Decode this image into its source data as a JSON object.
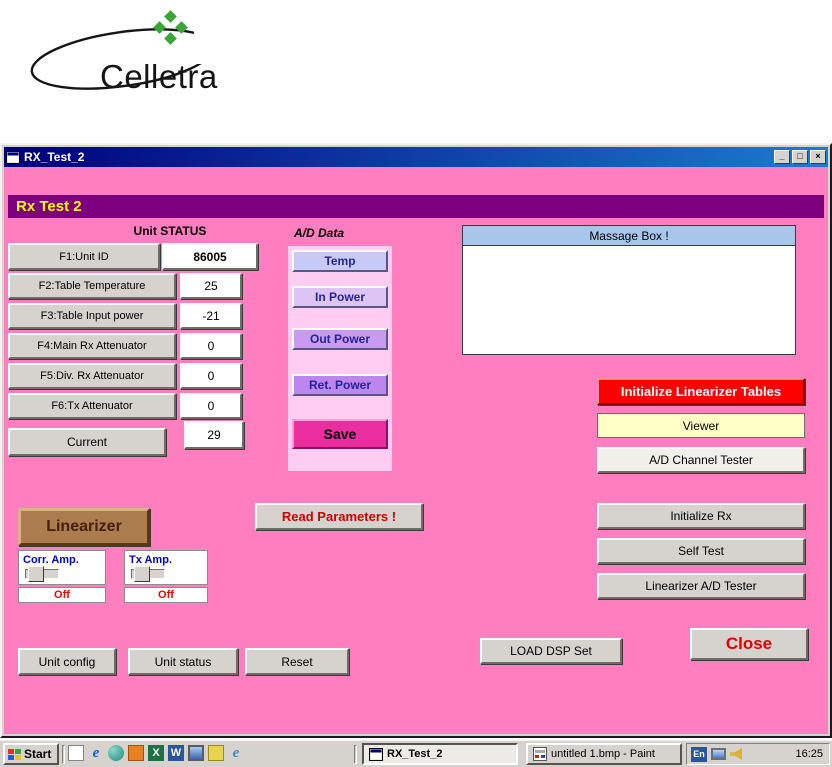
{
  "brand": {
    "name": "Celletra"
  },
  "window": {
    "title": "RX_Test_2",
    "page_title": "Rx Test 2",
    "controls": {
      "minimize": "_",
      "maximize": "□",
      "close": "×"
    }
  },
  "status_panel": {
    "header": "Unit STATUS",
    "rows": [
      {
        "label": "F1:Unit ID",
        "value": "86005"
      },
      {
        "label": "F2:Table Temperature",
        "value": "25"
      },
      {
        "label": "F3:Table Input power",
        "value": "-21"
      },
      {
        "label": "F4:Main Rx Attenuator",
        "value": "0"
      },
      {
        "label": "F5:Div. Rx Attenuator",
        "value": "0"
      },
      {
        "label": "F6:Tx Attenuator",
        "value": "0"
      }
    ],
    "current_label": "Current",
    "current_value": "29"
  },
  "ad_panel": {
    "header": "A/D Data",
    "channels": [
      "Temp",
      "In Power",
      "Out Power",
      "Ret. Power"
    ],
    "save": "Save"
  },
  "message_box": {
    "title": "Massage Box !",
    "content": ""
  },
  "actions": {
    "read_parameters": "Read Parameters !",
    "initialize_linearizer_tables": "Initialize Linearizer Tables",
    "viewer": "Viewer",
    "ad_channel_tester": "A/D Channel Tester",
    "initialize_rx": "Initialize Rx",
    "self_test": "Self Test",
    "linearizer_ad_tester": "Linearizer A/D Tester",
    "close": "Close",
    "load_dsp_set": "LOAD DSP Set",
    "unit_config": "Unit config",
    "unit_status": "Unit status",
    "reset": "Reset"
  },
  "linearizer": {
    "title": "Linearizer",
    "corr_amp": {
      "label": "Corr. Amp.",
      "state": "Off"
    },
    "tx_amp": {
      "label": "Tx Amp.",
      "state": "Off"
    }
  },
  "taskbar": {
    "start": "Start",
    "tasks": [
      {
        "label": "RX_Test_2"
      },
      {
        "label": "untitled 1.bmp - Paint"
      }
    ],
    "tray": {
      "language": "En",
      "time": "16:25"
    }
  },
  "icons": {
    "ie_glyph": "e",
    "excel_glyph": "X",
    "word_glyph": "W"
  },
  "colors": {
    "client_bg": "#ff7ec0",
    "page_header_bg": "#7e007e",
    "page_header_fg": "#ffff00",
    "danger": "#ff0000",
    "save_bg": "#ea2ea0",
    "viewer_bg": "#ffffc6",
    "linearizer_bg": "#ab7c4e"
  }
}
